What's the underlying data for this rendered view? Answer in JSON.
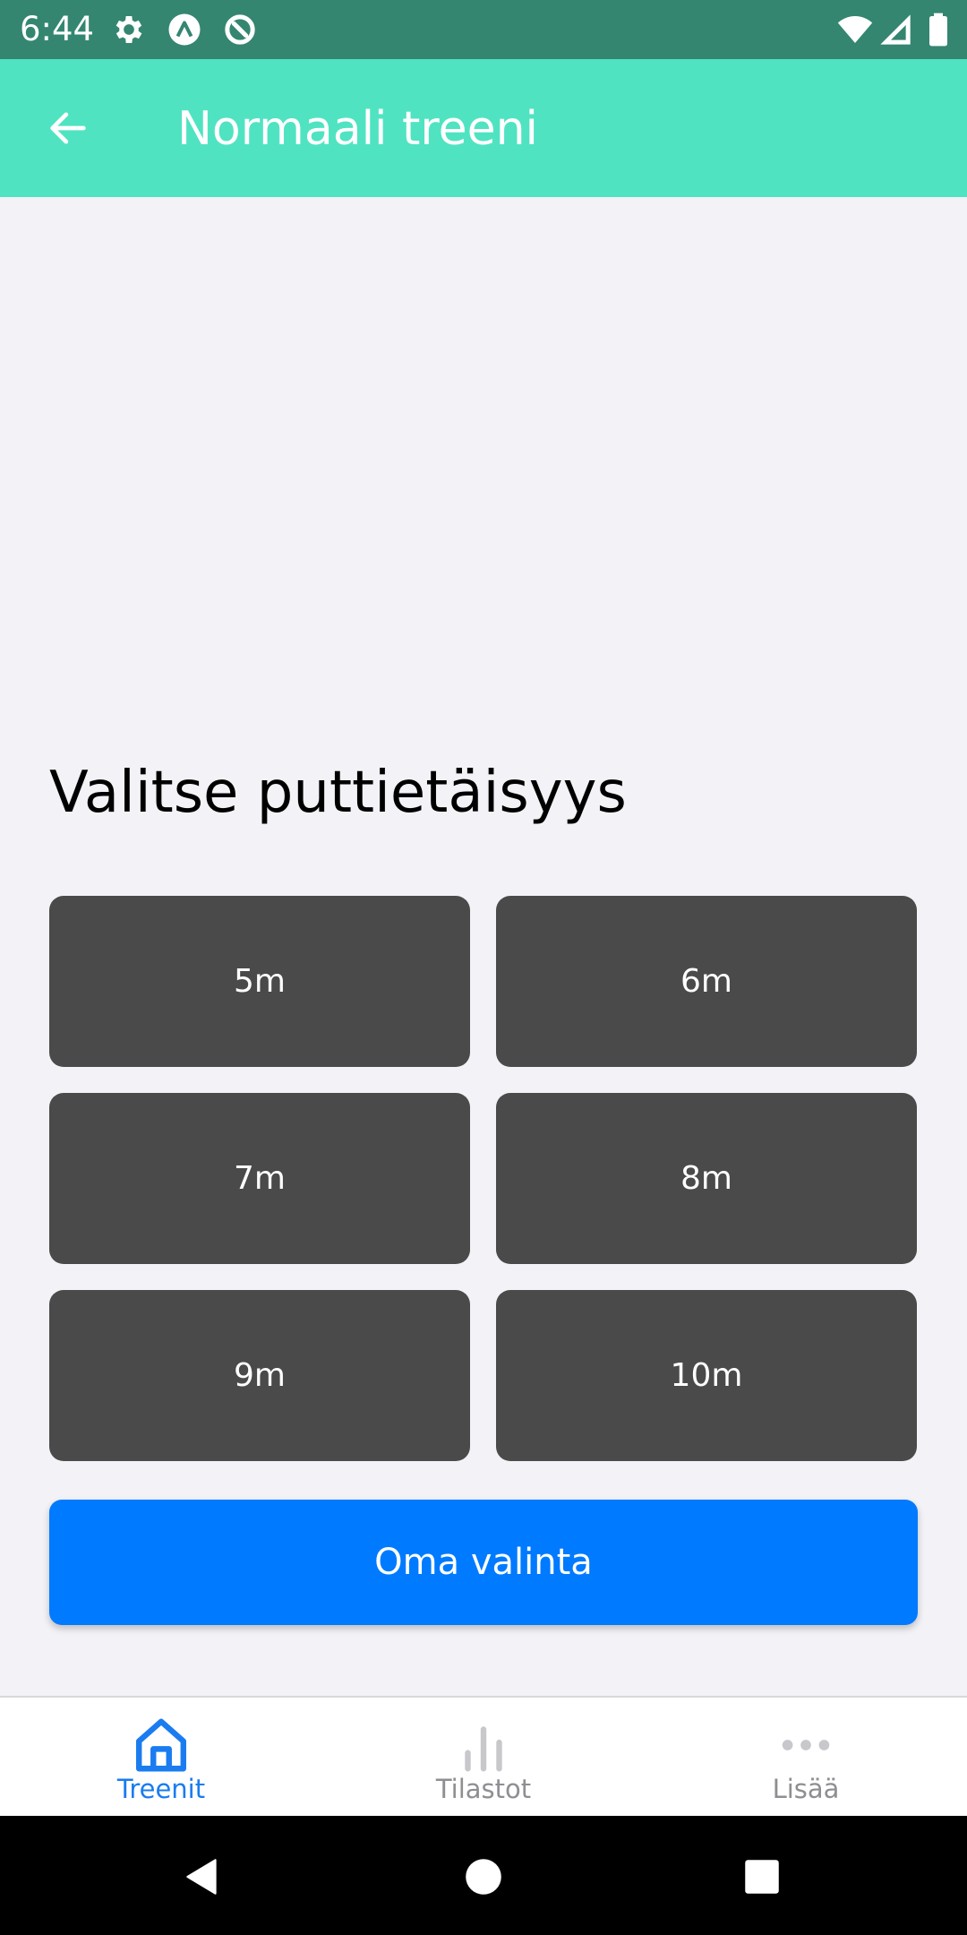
{
  "status_bar": {
    "time": "6:44",
    "left_icons": [
      "settings-icon",
      "app-a-icon",
      "app-sync-icon"
    ],
    "right_icons": [
      "wifi-icon",
      "cell-signal-icon",
      "battery-icon"
    ],
    "background": "#348670"
  },
  "app_bar": {
    "title": "Normaali treeni",
    "back_icon": "arrow-left-icon",
    "background": "#50E3C2"
  },
  "content": {
    "heading": "Valitse puttietäisyys",
    "distance_options": [
      {
        "label": "5m"
      },
      {
        "label": "6m"
      },
      {
        "label": "7m"
      },
      {
        "label": "8m"
      },
      {
        "label": "9m"
      },
      {
        "label": "10m"
      }
    ],
    "custom_button_label": "Oma valinta",
    "option_color": "#4A4A4A",
    "accent_color": "#007AFF"
  },
  "tabs": [
    {
      "label": "Treenit",
      "icon": "home-icon",
      "active": true
    },
    {
      "label": "Tilastot",
      "icon": "bar-chart-icon",
      "active": false
    },
    {
      "label": "Lisää",
      "icon": "more-dots-icon",
      "active": false
    }
  ],
  "tab_colors": {
    "active": "#1A7CF0",
    "inactive": "#8E8E93"
  },
  "nav_bar": {
    "buttons": [
      "back-triangle-icon",
      "home-circle-icon",
      "recents-square-icon"
    ]
  }
}
